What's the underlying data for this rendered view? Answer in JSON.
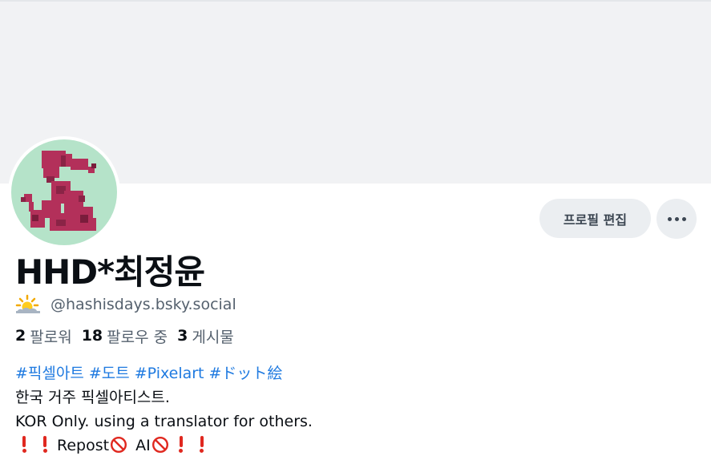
{
  "profile": {
    "display_name": "HHD*최정윤",
    "status_icon": "sun-behind-cloud-icon",
    "handle": "@hashisdays.bsky.social",
    "followers_count": "2",
    "followers_label": "팔로워",
    "following_count": "18",
    "following_label": "팔로우 중",
    "posts_count": "3",
    "posts_label": "게시물",
    "avatar_icon": "pixel-poodle-avatar",
    "colors": {
      "avatar_bg": "#b5e3c9",
      "avatar_figure": "#b3305a",
      "link": "#1f7ae0",
      "banner": "#f1f2f4"
    }
  },
  "actions": {
    "edit_profile_label": "프로필 편집",
    "more_icon": "ellipsis-icon"
  },
  "bio": {
    "hashtags": [
      "#픽셀아트",
      "#도트",
      "#Pixelart",
      "#ドット絵"
    ],
    "line2": "한국 거주 픽셀아티스트.",
    "line3": "KOR Only. using a translator for others.",
    "repost_text": "Repost",
    "ai_text": "AI",
    "emoji_icons": [
      "exclamation-icon",
      "exclamation-icon",
      "no-entry-icon",
      "no-entry-icon",
      "exclamation-icon",
      "exclamation-icon"
    ]
  }
}
